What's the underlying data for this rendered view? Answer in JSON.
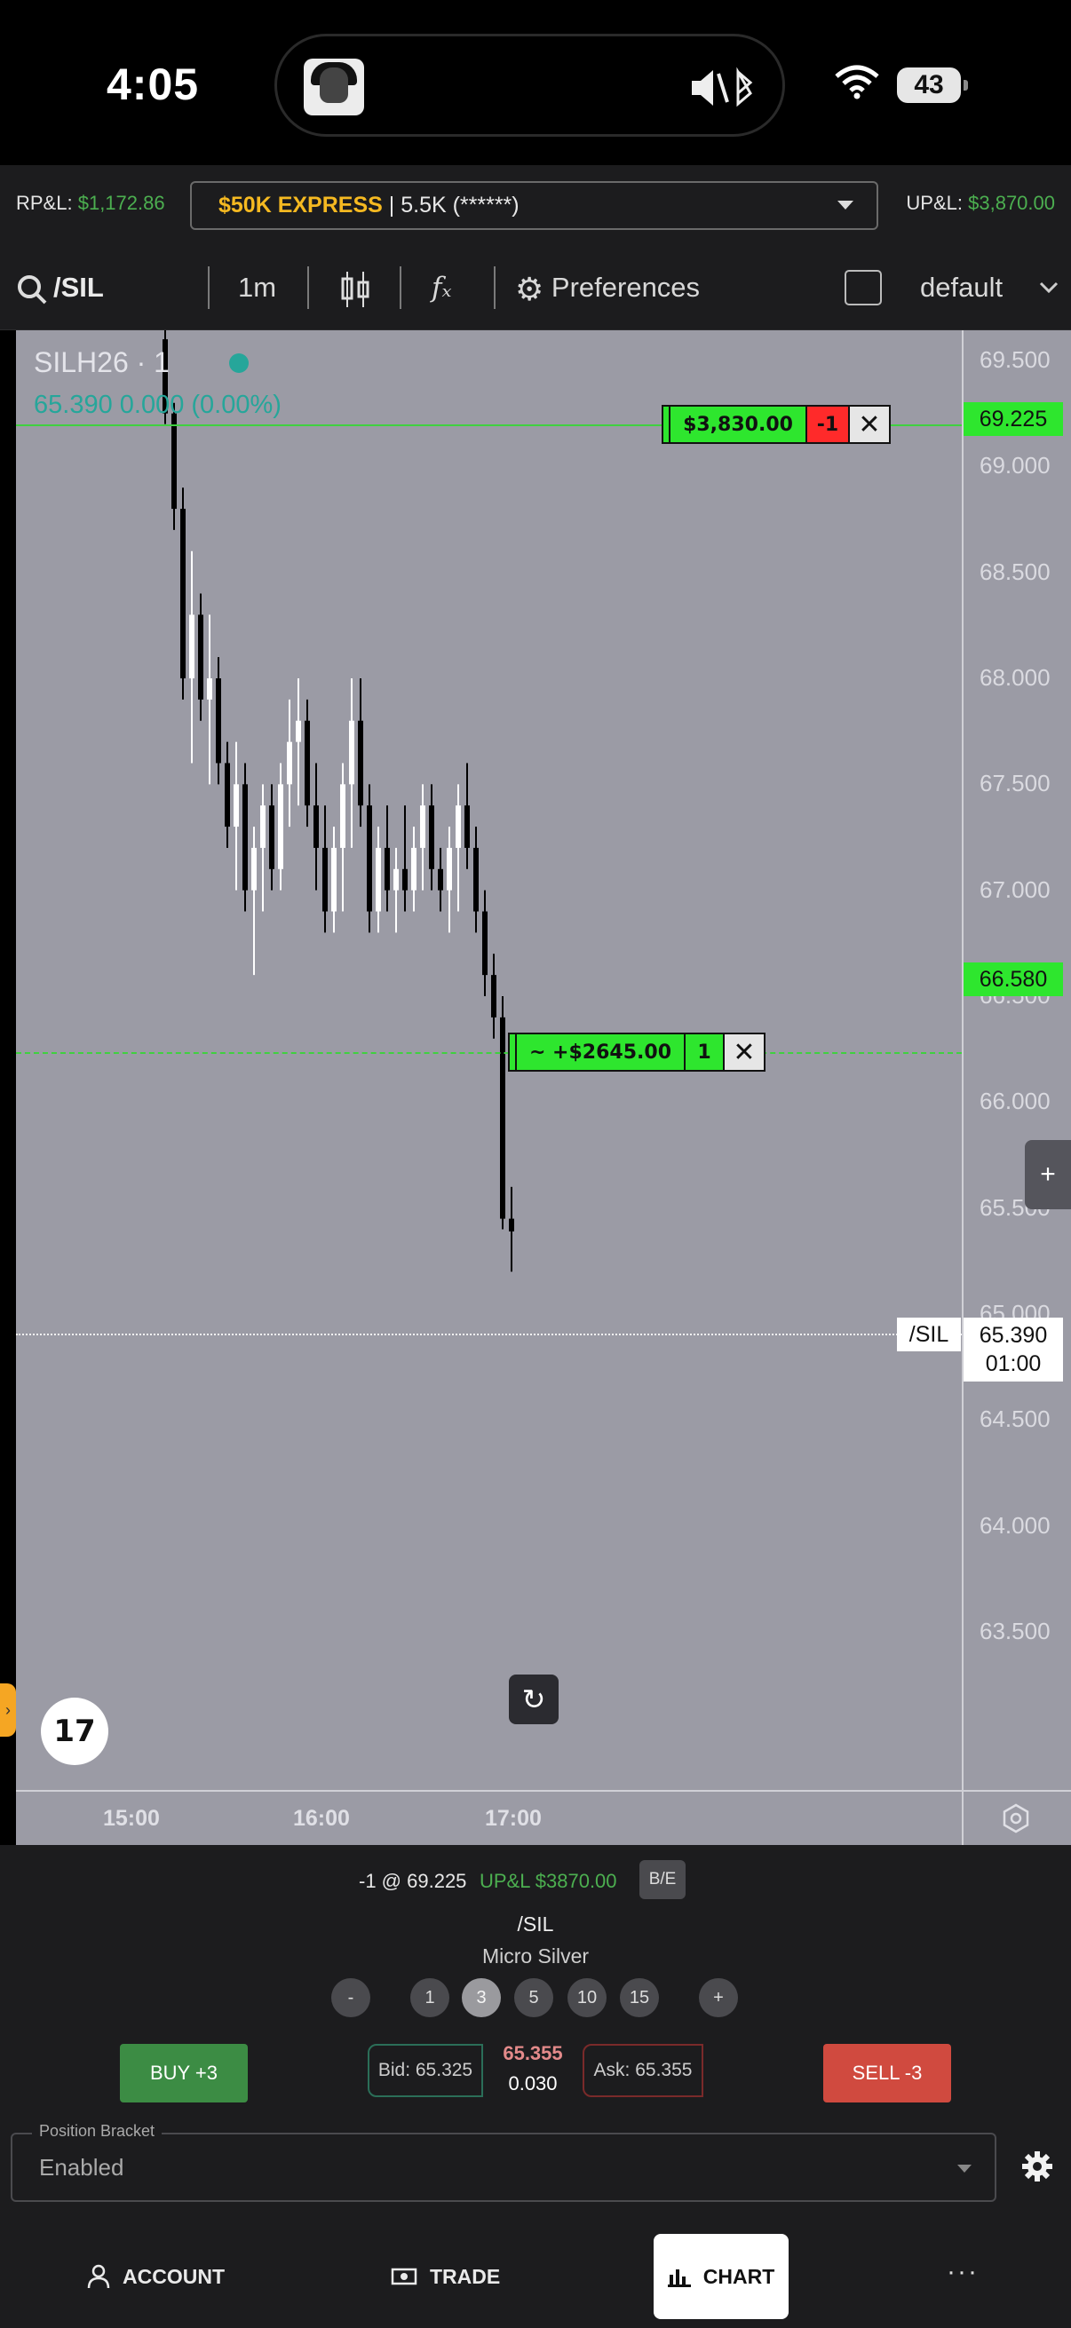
{
  "status_bar": {
    "time": "4:05",
    "battery": "43"
  },
  "header": {
    "rpl_label": "RP&L:",
    "rpl_value": "$1,172.86",
    "account_name": "$50K EXPRESS",
    "account_rest": " | 5.5K (******)",
    "upl_label": "UP&L:",
    "upl_value": "$3,870.00"
  },
  "toolbar": {
    "symbol": "/SIL",
    "interval": "1m",
    "fx_label": "fₓ",
    "preferences": "Preferences",
    "layout": "default"
  },
  "chart": {
    "legend_title": "SILH26 · 1",
    "legend_values": "65.390  0.000 (0.00%)",
    "price_labels": [
      "69.500",
      "69.000",
      "68.500",
      "68.000",
      "67.500",
      "67.000",
      "66.500",
      "66.000",
      "65.500",
      "65.000",
      "64.500",
      "64.000",
      "63.500"
    ],
    "time_labels": [
      "15:00",
      "16:00",
      "17:00"
    ],
    "order_price": "69.225",
    "order_pnl": "$3,830.00",
    "order_qty": "-1",
    "position_price": "66.580",
    "position_pnl": "~ +$2645.00",
    "position_qty": "1",
    "last_symbol": "/SIL",
    "last_price": "65.390",
    "countdown": "01:00",
    "logo": "17",
    "colors": {
      "background": "#9b9ba5",
      "up": "#ffffff",
      "down": "#000000",
      "accent": "#26a69a",
      "order_green": "#2ee62e"
    }
  },
  "chart_data": {
    "type": "candlestick",
    "symbol": "SILH26",
    "interval": "1m",
    "x_labels": [
      "15:00",
      "16:00",
      "17:00"
    ],
    "ylim": [
      63.5,
      69.5
    ],
    "grid": false,
    "candles": [
      {
        "o": 69.6,
        "h": 69.7,
        "l": 69.2,
        "c": 69.25,
        "up": false
      },
      {
        "o": 69.25,
        "h": 69.3,
        "l": 68.7,
        "c": 68.8,
        "up": false
      },
      {
        "o": 68.8,
        "h": 68.9,
        "l": 67.9,
        "c": 68.0,
        "up": false
      },
      {
        "o": 68.0,
        "h": 68.6,
        "l": 67.6,
        "c": 68.3,
        "up": true
      },
      {
        "o": 68.3,
        "h": 68.4,
        "l": 67.8,
        "c": 67.9,
        "up": false
      },
      {
        "o": 67.9,
        "h": 68.3,
        "l": 67.5,
        "c": 68.0,
        "up": true
      },
      {
        "o": 68.0,
        "h": 68.1,
        "l": 67.5,
        "c": 67.6,
        "up": false
      },
      {
        "o": 67.6,
        "h": 67.7,
        "l": 67.2,
        "c": 67.3,
        "up": false
      },
      {
        "o": 67.3,
        "h": 67.7,
        "l": 67.0,
        "c": 67.5,
        "up": true
      },
      {
        "o": 67.5,
        "h": 67.6,
        "l": 66.9,
        "c": 67.0,
        "up": false
      },
      {
        "o": 67.0,
        "h": 67.3,
        "l": 66.6,
        "c": 67.2,
        "up": true
      },
      {
        "o": 67.2,
        "h": 67.5,
        "l": 66.9,
        "c": 67.4,
        "up": true
      },
      {
        "o": 67.4,
        "h": 67.5,
        "l": 67.0,
        "c": 67.1,
        "up": false
      },
      {
        "o": 67.1,
        "h": 67.6,
        "l": 67.0,
        "c": 67.5,
        "up": true
      },
      {
        "o": 67.5,
        "h": 67.9,
        "l": 67.3,
        "c": 67.7,
        "up": true
      },
      {
        "o": 67.7,
        "h": 68.0,
        "l": 67.4,
        "c": 67.8,
        "up": true
      },
      {
        "o": 67.8,
        "h": 67.9,
        "l": 67.3,
        "c": 67.4,
        "up": false
      },
      {
        "o": 67.4,
        "h": 67.6,
        "l": 67.0,
        "c": 67.2,
        "up": false
      },
      {
        "o": 67.2,
        "h": 67.4,
        "l": 66.8,
        "c": 66.9,
        "up": false
      },
      {
        "o": 66.9,
        "h": 67.3,
        "l": 66.8,
        "c": 67.2,
        "up": true
      },
      {
        "o": 67.2,
        "h": 67.6,
        "l": 66.9,
        "c": 67.5,
        "up": true
      },
      {
        "o": 67.5,
        "h": 68.0,
        "l": 67.2,
        "c": 67.8,
        "up": true
      },
      {
        "o": 67.8,
        "h": 68.0,
        "l": 67.3,
        "c": 67.4,
        "up": false
      },
      {
        "o": 67.4,
        "h": 67.5,
        "l": 66.8,
        "c": 66.9,
        "up": false
      },
      {
        "o": 66.9,
        "h": 67.3,
        "l": 66.8,
        "c": 67.2,
        "up": true
      },
      {
        "o": 67.2,
        "h": 67.4,
        "l": 66.9,
        "c": 67.0,
        "up": false
      },
      {
        "o": 67.0,
        "h": 67.2,
        "l": 66.8,
        "c": 67.1,
        "up": true
      },
      {
        "o": 67.1,
        "h": 67.4,
        "l": 66.9,
        "c": 67.0,
        "up": false
      },
      {
        "o": 67.0,
        "h": 67.3,
        "l": 66.9,
        "c": 67.2,
        "up": true
      },
      {
        "o": 67.2,
        "h": 67.5,
        "l": 67.0,
        "c": 67.4,
        "up": true
      },
      {
        "o": 67.4,
        "h": 67.5,
        "l": 67.0,
        "c": 67.1,
        "up": false
      },
      {
        "o": 67.1,
        "h": 67.2,
        "l": 66.9,
        "c": 67.0,
        "up": false
      },
      {
        "o": 67.0,
        "h": 67.3,
        "l": 66.8,
        "c": 67.2,
        "up": true
      },
      {
        "o": 67.2,
        "h": 67.5,
        "l": 66.9,
        "c": 67.4,
        "up": true
      },
      {
        "o": 67.4,
        "h": 67.6,
        "l": 67.1,
        "c": 67.2,
        "up": false
      },
      {
        "o": 67.2,
        "h": 67.3,
        "l": 66.8,
        "c": 66.9,
        "up": false
      },
      {
        "o": 66.9,
        "h": 67.0,
        "l": 66.5,
        "c": 66.6,
        "up": false
      },
      {
        "o": 66.6,
        "h": 66.7,
        "l": 66.3,
        "c": 66.4,
        "up": false
      },
      {
        "o": 66.4,
        "h": 66.5,
        "l": 65.4,
        "c": 65.45,
        "up": false
      },
      {
        "o": 65.45,
        "h": 65.6,
        "l": 65.2,
        "c": 65.39,
        "up": false
      }
    ]
  },
  "panel": {
    "position_text": "-1 @ 69.225",
    "position_upl": "UP&L $3870.00",
    "be_label": "B/E",
    "symbol": "/SIL",
    "description": "Micro Silver",
    "qty_minus": "-",
    "qty_options": [
      "1",
      "3",
      "5",
      "10",
      "15"
    ],
    "qty_plus": "+",
    "buy_label": "BUY +3",
    "sell_label": "SELL -3",
    "bid": "Bid: 65.325",
    "ask": "Ask: 65.355",
    "mid_price": "65.355",
    "spread": "0.030",
    "bracket_label": "Position Bracket",
    "bracket_value": "Enabled"
  },
  "nav": {
    "account": "ACCOUNT",
    "trade": "TRADE",
    "chart": "CHART",
    "more": "···"
  }
}
